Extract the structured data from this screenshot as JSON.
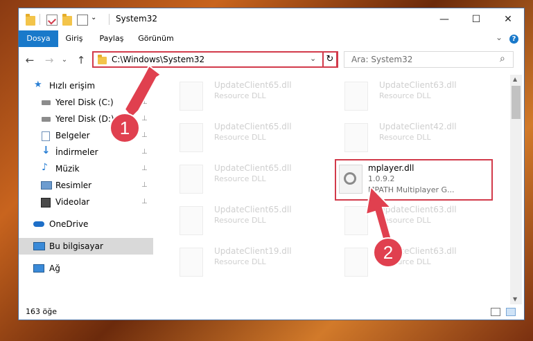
{
  "window": {
    "title": "System32",
    "controls": {
      "minimize": "—",
      "maximize": "☐",
      "close": "✕"
    }
  },
  "ribbon": {
    "tabs": [
      "Dosya",
      "Giriş",
      "Paylaş",
      "Görünüm"
    ],
    "expand_glyph": "⌄",
    "help_glyph": "?"
  },
  "nav": {
    "back": "←",
    "forward": "→",
    "history": "⌄",
    "up": "↑",
    "address": "C:\\Windows\\System32",
    "dropdown": "⌄",
    "refresh": "↻",
    "search_placeholder": "Ara: System32",
    "search_icon": "⌕"
  },
  "sidebar": {
    "items": [
      {
        "label": "Hızlı erişim",
        "icon": "star-icon",
        "pinned": false
      },
      {
        "label": "Yerel Disk (C:)",
        "icon": "drive-icon",
        "pinned": true
      },
      {
        "label": "Yerel Disk (D:)",
        "icon": "drive-icon",
        "pinned": true
      },
      {
        "label": "Belgeler",
        "icon": "documents-icon",
        "pinned": true
      },
      {
        "label": "İndirmeler",
        "icon": "download-icon",
        "pinned": true
      },
      {
        "label": "Müzik",
        "icon": "music-icon",
        "pinned": true
      },
      {
        "label": "Resimler",
        "icon": "pictures-icon",
        "pinned": true
      },
      {
        "label": "Videolar",
        "icon": "videos-icon",
        "pinned": true
      },
      {
        "label": "OneDrive",
        "icon": "cloud-icon",
        "pinned": false
      },
      {
        "label": "Bu bilgisayar",
        "icon": "computer-icon",
        "pinned": false
      },
      {
        "label": "Ağ",
        "icon": "network-icon",
        "pinned": false
      }
    ],
    "pin_glyph": "📌"
  },
  "files": [
    {
      "name": "UpdateClient65.dll",
      "sub1": "Resource DLL",
      "sub2": ""
    },
    {
      "name": "UpdateClient63.dll",
      "sub1": "Resource DLL",
      "sub2": ""
    },
    {
      "name": "UpdateClient65.dll",
      "sub1": "Resource DLL",
      "sub2": ""
    },
    {
      "name": "UpdateClient42.dll",
      "sub1": "Resource DLL",
      "sub2": ""
    },
    {
      "name": "UpdateClient65.dll",
      "sub1": "Resource DLL",
      "sub2": ""
    },
    {
      "name": "mplayer.dll",
      "sub1": "1.0.9.2",
      "sub2": "MPATH Multiplayer G..."
    },
    {
      "name": "UpdateClient65.dll",
      "sub1": "Resource DLL",
      "sub2": ""
    },
    {
      "name": "UpdateClient63.dll",
      "sub1": "Resource DLL",
      "sub2": ""
    },
    {
      "name": "UpdateClient19.dll",
      "sub1": "Resource DLL",
      "sub2": ""
    },
    {
      "name": "UpdateClient63.dll",
      "sub1": "Resource DLL",
      "sub2": ""
    }
  ],
  "status": {
    "count": "163 öğe"
  },
  "callouts": {
    "one": "1",
    "two": "2"
  },
  "colors": {
    "accent": "#1979ca",
    "highlight": "#d23a4a",
    "callout": "#e0404f"
  }
}
